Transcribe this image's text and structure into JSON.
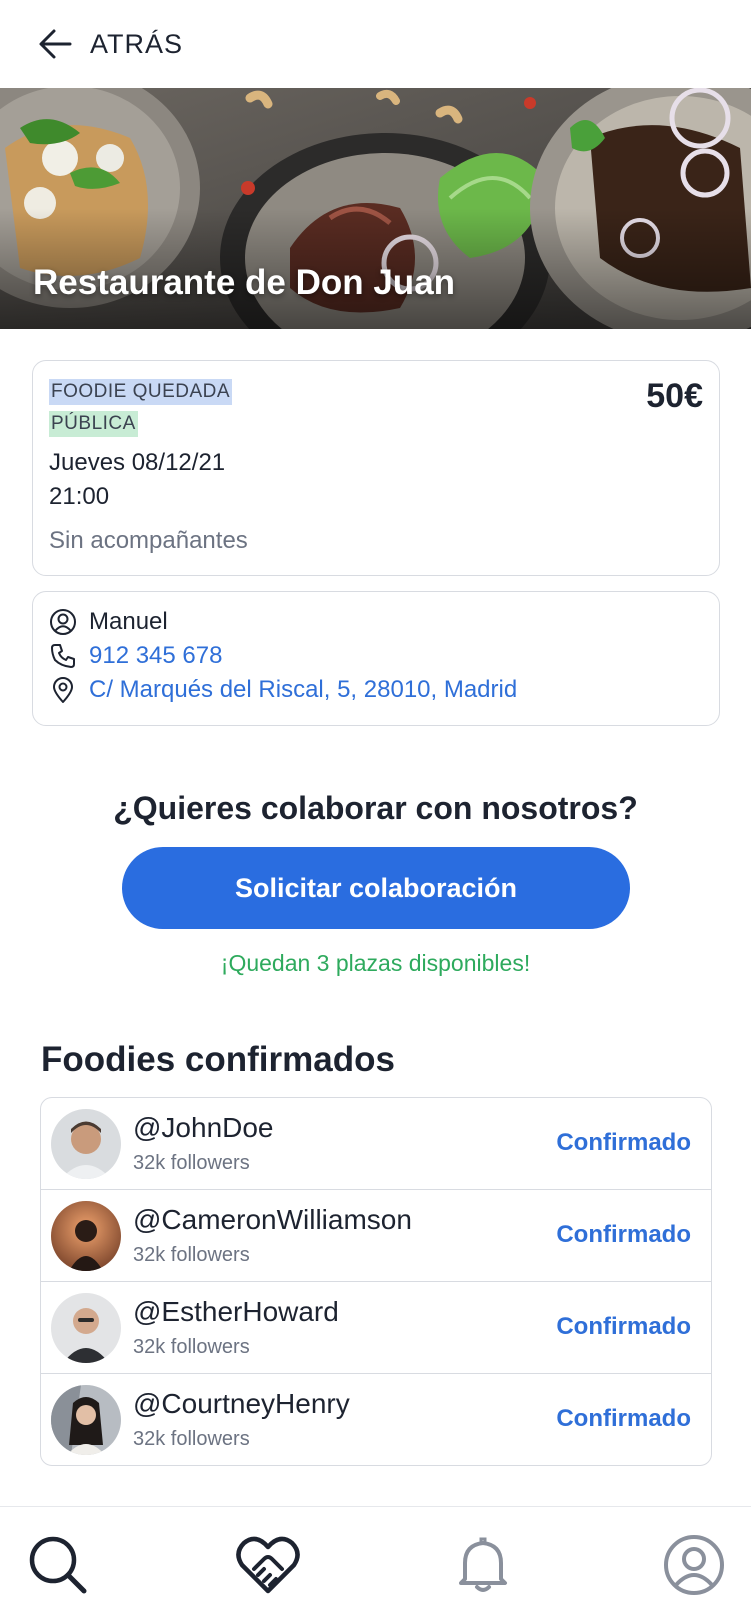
{
  "header": {
    "back_label": "ATRÁS"
  },
  "hero": {
    "title": "Restaurante de Don Juan"
  },
  "event": {
    "type": "FOODIE QUEDADA",
    "visibility": "PÚBLICA",
    "price": "50€",
    "date": "Jueves 08/12/21",
    "time": "21:00",
    "companions": "Sin acompañantes"
  },
  "contact": {
    "name": "Manuel",
    "phone": "912 345 678",
    "address": "C/ Marqués del Riscal, 5, 28010, Madrid"
  },
  "collab": {
    "question": "¿Quieres colaborar con nosotros?",
    "button": "Solicitar colaboración",
    "seats": "¡Quedan 3 plazas disponibles!"
  },
  "foodies": {
    "title": "Foodies confirmados",
    "items": [
      {
        "handle": "@JohnDoe",
        "followers": "32k followers",
        "status": "Confirmado"
      },
      {
        "handle": "@CameronWilliamson",
        "followers": "32k followers",
        "status": "Confirmado"
      },
      {
        "handle": "@EstherHoward",
        "followers": "32k followers",
        "status": "Confirmado"
      },
      {
        "handle": "@CourtneyHenry",
        "followers": "32k followers",
        "status": "Confirmado"
      }
    ]
  },
  "nav": {
    "items": [
      {
        "icon": "search-icon"
      },
      {
        "icon": "handshake-heart-icon"
      },
      {
        "icon": "bell-icon"
      },
      {
        "icon": "user-circle-icon"
      }
    ]
  },
  "colors": {
    "accent": "#2a6de0",
    "link": "#2f6fd8",
    "success": "#2eaa5d",
    "text": "#1d2330",
    "muted": "#6c7382"
  }
}
